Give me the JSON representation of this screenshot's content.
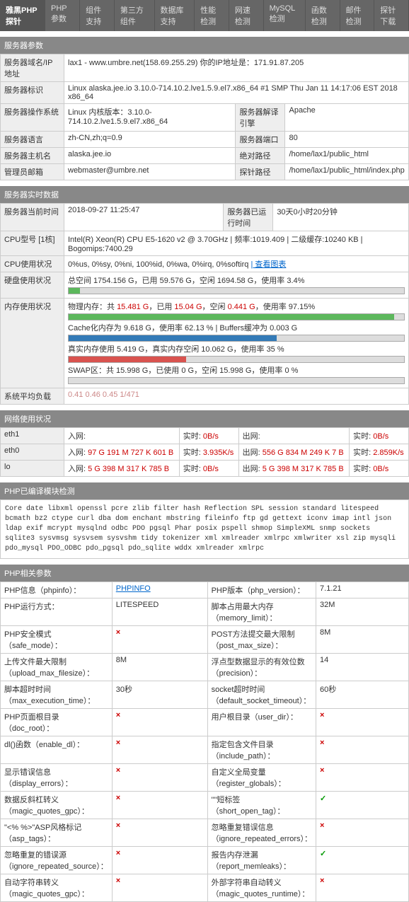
{
  "nav": {
    "title": "雅黑PHP探针",
    "tabs": [
      "PHP参数",
      "组件支持",
      "第三方组件",
      "数据库支持",
      "性能检测",
      "网速检测",
      "MySQL检测",
      "函数检测",
      "邮件检测",
      "探针下载"
    ]
  },
  "sec1": {
    "header": "服务器参数",
    "rows": [
      {
        "l": "服务器域名/IP地址",
        "v": "lax1 - www.umbre.net(158.69.255.29) 你的IP地址是：171.91.87.205"
      },
      {
        "l": "服务器标识",
        "v": "Linux alaska.jee.io 3.10.0-714.10.2.lve1.5.9.el7.x86_64 #1 SMP Thu Jan 11 14:17:06 EST 2018 x86_64"
      }
    ],
    "os": {
      "l": "服务器操作系统",
      "v": "Linux  内核版本：3.10.0-714.10.2.lve1.5.9.el7.x86_64",
      "l2": "服务器解译引擎",
      "v2": "Apache"
    },
    "lang": {
      "l": "服务器语言",
      "v": "zh-CN,zh;q=0.9",
      "l2": "服务器端口",
      "v2": "80"
    },
    "host": {
      "l": "服务器主机名",
      "v": "alaska.jee.io",
      "l2": "绝对路径",
      "v2": "/home/lax1/public_html"
    },
    "admin": {
      "l": "管理员邮箱",
      "v": "webmaster@umbre.net",
      "l2": "探针路径",
      "v2": "/home/lax1/public_html/index.php"
    }
  },
  "sec2": {
    "header": "服务器实时数据",
    "time": {
      "l": "服务器当前时间",
      "v": "2018-09-27 11:25:47",
      "l2": "服务器已运行时间",
      "v2": "30天0小时20分钟"
    },
    "cpu": {
      "l": "CPU型号 [1核]",
      "v": "Intel(R) Xeon(R) CPU E5-1620 v2 @ 3.70GHz | 频率:1019.409 | 二级缓存:10240 KB | Bogomips:7400.29"
    },
    "cpuuse": {
      "l": "CPU使用状况",
      "v": "0%us, 0%sy, 0%ni, 100%id, 0%wa, 0%irq, 0%softirq",
      "link": "| 查看图表"
    },
    "disk": {
      "l": "硬盘使用状况",
      "v": "总空间 1754.156 G，已用 59.576 G，空闲 1694.58 G，使用率 3.4%",
      "pct": 3.4
    },
    "mem": {
      "l": "内存使用状况",
      "lines": [
        {
          "pre": "物理内存：共 ",
          "r1": "15.481 G",
          "mid": "，已用 ",
          "r2": "15.04 G",
          "mid2": "，空闲 ",
          "r3": "0.441 G",
          "post": "，使用率 97.15%",
          "pct": 97,
          "color": "green"
        },
        {
          "text": "Cache化内存为 9.618 G，使用率 62.13 % | Buffers缓冲为 0.003 G",
          "pct": 62,
          "color": "blue"
        },
        {
          "text": "真实内存使用 5.419 G，真实内存空闲 10.062 G，使用率 35 %",
          "pct": 35,
          "color": "red"
        },
        {
          "text": "SWAP区：共 15.998 G，已使用 0 G，空闲 15.998 G，使用率 0 %",
          "pct": 0,
          "color": "green"
        }
      ]
    },
    "load": {
      "l": "系统平均负载",
      "v": "0.41 0.46 0.45 1/471"
    }
  },
  "sec3": {
    "header": "网络使用状况",
    "rows": [
      {
        "iface": "eth1",
        "in": "入网:",
        "in2": "",
        "inr": "实时:",
        "inrv": "0B/s",
        "out": "出网:",
        "out2": "",
        "outr": "实时:",
        "outrv": "0B/s"
      },
      {
        "iface": "eth0",
        "in": "入网:",
        "in2": "97 G 191 M 727 K 601 B",
        "inr": "实时:",
        "inrv": "3.935K/s",
        "out": "出网:",
        "out2": "556 G 834 M 249 K 7 B",
        "outr": "实时:",
        "outrv": "2.859K/s"
      },
      {
        "iface": "lo",
        "in": "入网:",
        "in2": "5 G 398 M 317 K 785 B",
        "inr": "实时:",
        "inrv": "0B/s",
        "out": "出网:",
        "out2": "5 G 398 M 317 K 785 B",
        "outr": "实时:",
        "outrv": "0B/s"
      }
    ]
  },
  "sec4": {
    "header": "PHP已编译模块检测",
    "text": "Core  date  libxml  openssl  pcre  zlib  filter  hash  Reflection  SPL  session  standard  litespeed  bcmath  bz2  ctype  curl  dba  dom  enchant  mbstring  fileinfo  ftp  gd  gettext  iconv  imap  intl  json  ldap  exif  mcrypt  mysqlnd  odbc  PDO  pgsql  Phar  posix  pspell  shmop  SimpleXML  snmp  sockets  sqlite3  sysvmsg  sysvsem  sysvshm  tidy  tokenizer  xml  xmlreader  xmlrpc  xmlwriter  xsl  zip  mysqli  pdo_mysql  PDO_ODBC  pdo_pgsql  pdo_sqlite  wddx  xmlreader  xmlrpc"
  },
  "sec5": {
    "header": "PHP相关参数",
    "rows": [
      {
        "a": "PHP信息（phpinfo）：",
        "b": "PHPINFO",
        "c": "PHP版本（php_version）：",
        "d": "7.1.21"
      },
      {
        "a": "PHP运行方式：",
        "b": "LITESPEED",
        "c": "脚本占用最大内存（memory_limit）：",
        "d": "32M"
      },
      {
        "a": "PHP安全模式（safe_mode）：",
        "b": "x",
        "c": "POST方法提交最大限制（post_max_size）：",
        "d": "8M"
      },
      {
        "a": "上传文件最大限制（upload_max_filesize）：",
        "b": "8M",
        "c": "浮点型数据显示的有效位数（precision）：",
        "d": "14"
      },
      {
        "a": "脚本超时时间（max_execution_time）：",
        "b": "30秒",
        "c": "socket超时时间（default_socket_timeout）：",
        "d": "60秒"
      },
      {
        "a": "PHP页面根目录（doc_root）：",
        "b": "x",
        "c": "用户根目录（user_dir）：",
        "d": "x"
      },
      {
        "a": "dl()函数（enable_dl）：",
        "b": "x",
        "c": "指定包含文件目录（include_path）：",
        "d": "x"
      },
      {
        "a": "显示错误信息（display_errors）：",
        "b": "x",
        "c": "自定义全局变量（register_globals）：",
        "d": "x"
      },
      {
        "a": "数据反斜杠转义（magic_quotes_gpc）：",
        "b": "x",
        "c": "\"<?...?>\"短标签（short_open_tag）：",
        "d": "✓"
      },
      {
        "a": "\"<% %>\"ASP风格标记（asp_tags）：",
        "b": "x",
        "c": "忽略重复错误信息（ignore_repeated_errors）：",
        "d": "x"
      },
      {
        "a": "忽略重复的错误源（ignore_repeated_source）：",
        "b": "x",
        "c": "报告内存泄漏（report_memleaks）：",
        "d": "✓"
      },
      {
        "a": "自动字符串转义（magic_quotes_gpc）：",
        "b": "x",
        "c": "外部字符串自动转义（magic_quotes_runtime）：",
        "d": "x"
      }
    ]
  }
}
